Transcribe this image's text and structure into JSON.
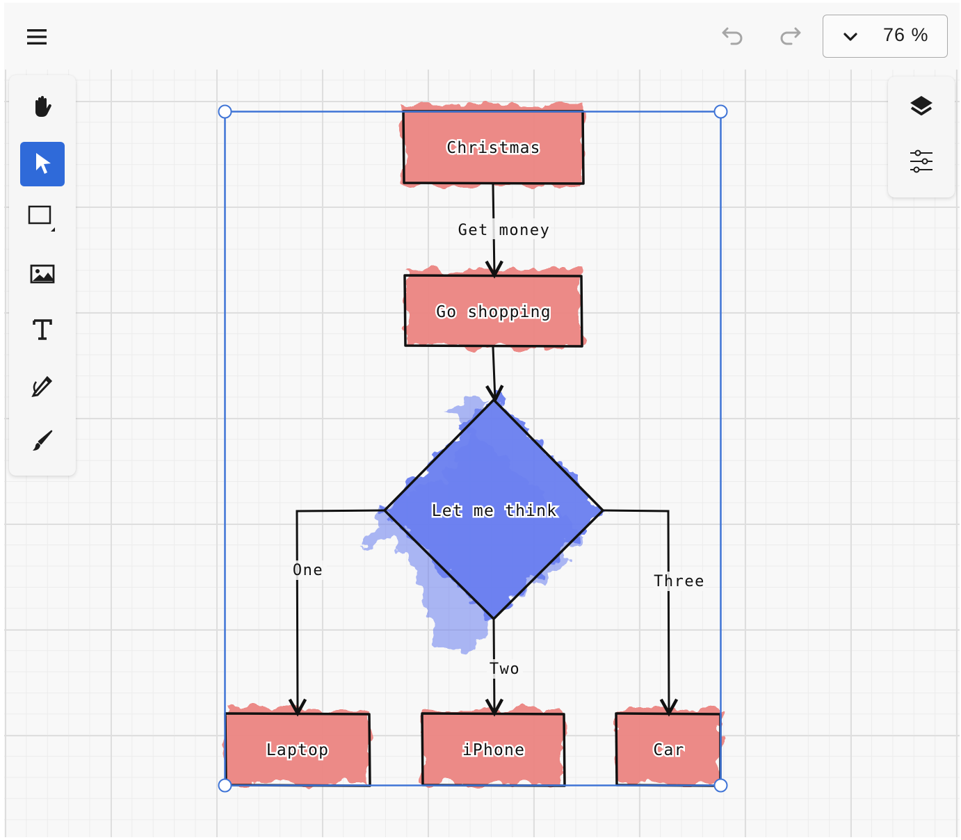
{
  "toolbar": {
    "menu_icon": "hamburger-menu-icon",
    "undo_icon": "undo-icon",
    "redo_icon": "redo-icon",
    "zoom": {
      "value": "76 %",
      "icon": "chevron-down-icon"
    }
  },
  "tools": [
    {
      "name": "hand-tool",
      "icon": "hand-icon",
      "active": false
    },
    {
      "name": "select-tool",
      "icon": "pointer-icon",
      "active": true
    },
    {
      "name": "rectangle-tool",
      "icon": "rectangle-icon",
      "active": false
    },
    {
      "name": "image-tool",
      "icon": "image-icon",
      "active": false
    },
    {
      "name": "text-tool",
      "icon": "text-icon",
      "active": false
    },
    {
      "name": "pen-tool",
      "icon": "pen-icon",
      "active": false
    },
    {
      "name": "brush-tool",
      "icon": "brush-icon",
      "active": false
    }
  ],
  "right_panel": [
    {
      "name": "layers-button",
      "icon": "layers-icon"
    },
    {
      "name": "style-settings-button",
      "icon": "sliders-icon"
    }
  ],
  "diagram": {
    "node_fill_colors": {
      "rectangle": "#ec8582",
      "diamond": "#6a7ff0"
    },
    "selection_color": "#3f74d6",
    "nodes": {
      "christmas": "Christmas",
      "go_shopping": "Go shopping",
      "decision": "Let me think",
      "laptop": "Laptop",
      "iphone": "iPhone",
      "car": "Car"
    },
    "edges": {
      "get_money": "Get money",
      "one": "One",
      "two": "Two",
      "three": "Three"
    }
  }
}
